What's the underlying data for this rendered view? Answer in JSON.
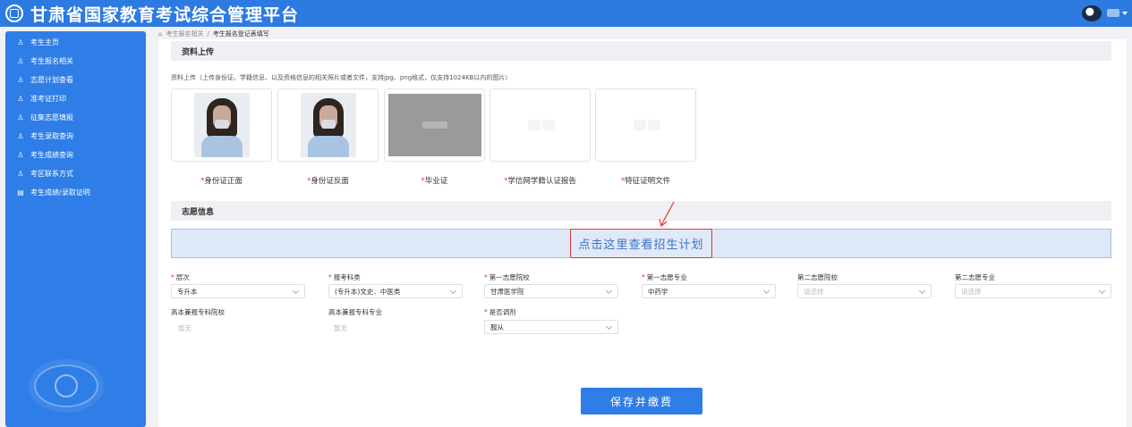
{
  "header": {
    "title": "甘肃省国家教育考试综合管理平台"
  },
  "sidebar": {
    "items": [
      {
        "label": "考生主页",
        "icon": "person-icon"
      },
      {
        "label": "考生报名相关",
        "icon": "person-icon"
      },
      {
        "label": "志愿计划查看",
        "icon": "person-icon"
      },
      {
        "label": "准考证打印",
        "icon": "person-icon"
      },
      {
        "label": "征集志愿填报",
        "icon": "person-icon"
      },
      {
        "label": "考生录取查询",
        "icon": "person-icon"
      },
      {
        "label": "考生成绩查询",
        "icon": "person-icon"
      },
      {
        "label": "考区联系方式",
        "icon": "person-icon"
      },
      {
        "label": "考生成绩/录取证明",
        "icon": "certificate-icon"
      }
    ]
  },
  "breadcrumb": {
    "parent": "考生报名相关",
    "separator": "/",
    "current": "考生报名登记表填写"
  },
  "upload": {
    "section_title": "资料上传",
    "hint": "资料上传（上传身份证、学籍信息、以及资格信息的相关照片或者文件，支持jpg、png格式，仅支持1024KB以内的图片）",
    "items": [
      {
        "label": "身份证正面",
        "required": "*"
      },
      {
        "label": "身份证反面",
        "required": "*"
      },
      {
        "label": "毕业证",
        "required": "*"
      },
      {
        "label": "学信网学籍认证报告",
        "required": "*"
      },
      {
        "label": "特征证明文件",
        "required": "*"
      }
    ]
  },
  "volunteer": {
    "section_title": "志愿信息",
    "plan_link": "点击这里查看招生计划",
    "fields": [
      {
        "label": "层次",
        "required": "*",
        "value": "专升本"
      },
      {
        "label": "报考科类",
        "required": "*",
        "value": "(专升本)文史、中医类"
      },
      {
        "label": "第一志愿院校",
        "required": "*",
        "value": "甘肃医学院"
      },
      {
        "label": "第一志愿专业",
        "required": "*",
        "value": "中药学"
      },
      {
        "label": "第二志愿院校",
        "required": "",
        "placeholder": "请选择"
      },
      {
        "label": "第二志愿专业",
        "required": "",
        "placeholder": "请选择"
      }
    ],
    "row2": [
      {
        "label": "高本兼报专科院校",
        "value": "暂无"
      },
      {
        "label": "高本兼报专科专业",
        "value": "暂无"
      },
      {
        "label": "是否调剂",
        "required": "*",
        "value": "服从"
      }
    ]
  },
  "actions": {
    "save_label": "保存并缴费"
  },
  "colors": {
    "primary": "#2f7de6",
    "header": "#2d7ae0",
    "required": "#e53935",
    "highlight_border": "#e03b32"
  }
}
